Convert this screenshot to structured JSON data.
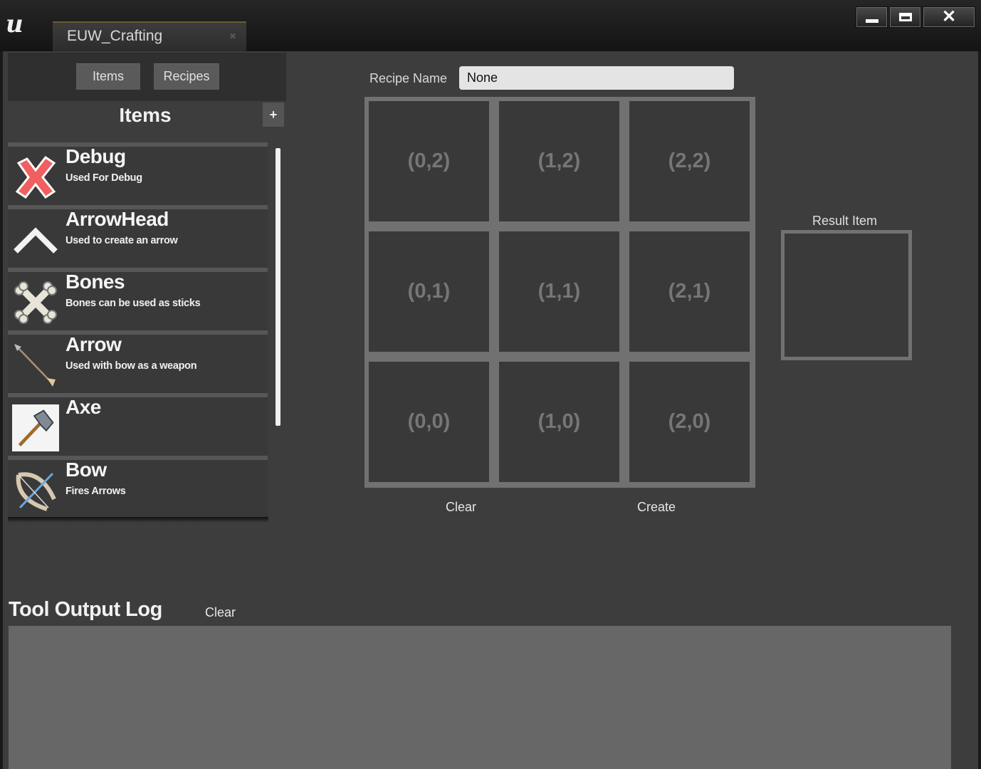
{
  "window": {
    "logo": "u",
    "tab_label": "EUW_Crafting",
    "tab_close": "✖",
    "buttons": [
      "minimize-button",
      "maximize-button",
      "close-button"
    ]
  },
  "left_panel": {
    "top_tabs": [
      "Items",
      "Recipes"
    ],
    "section_title": "Items",
    "add_button": "+",
    "items": [
      {
        "name": "Debug",
        "description": "Used For Debug",
        "icon": "red-x-icon"
      },
      {
        "name": "ArrowHead",
        "description": "Used to create an arrow",
        "icon": "arrowhead-icon"
      },
      {
        "name": "Bones",
        "description": "Bones can be used as sticks",
        "icon": "bones-icon"
      },
      {
        "name": "Arrow",
        "description": "Used with bow as a weapon",
        "icon": "arrow-icon"
      },
      {
        "name": "Axe",
        "description": "",
        "icon": "axe-icon"
      },
      {
        "name": "Bow",
        "description": "Fires Arrows",
        "icon": "bow-icon"
      }
    ]
  },
  "recipe": {
    "label": "Recipe Name",
    "value": "None",
    "grid": [
      [
        "(0,2)",
        "(1,2)",
        "(2,2)"
      ],
      [
        "(0,1)",
        "(1,1)",
        "(2,1)"
      ],
      [
        "(0,0)",
        "(1,0)",
        "(2,0)"
      ]
    ],
    "clear_label": "Clear",
    "create_label": "Create",
    "result_label": "Result Item"
  },
  "log": {
    "title": "Tool Output Log",
    "clear_label": "Clear",
    "content": ""
  }
}
